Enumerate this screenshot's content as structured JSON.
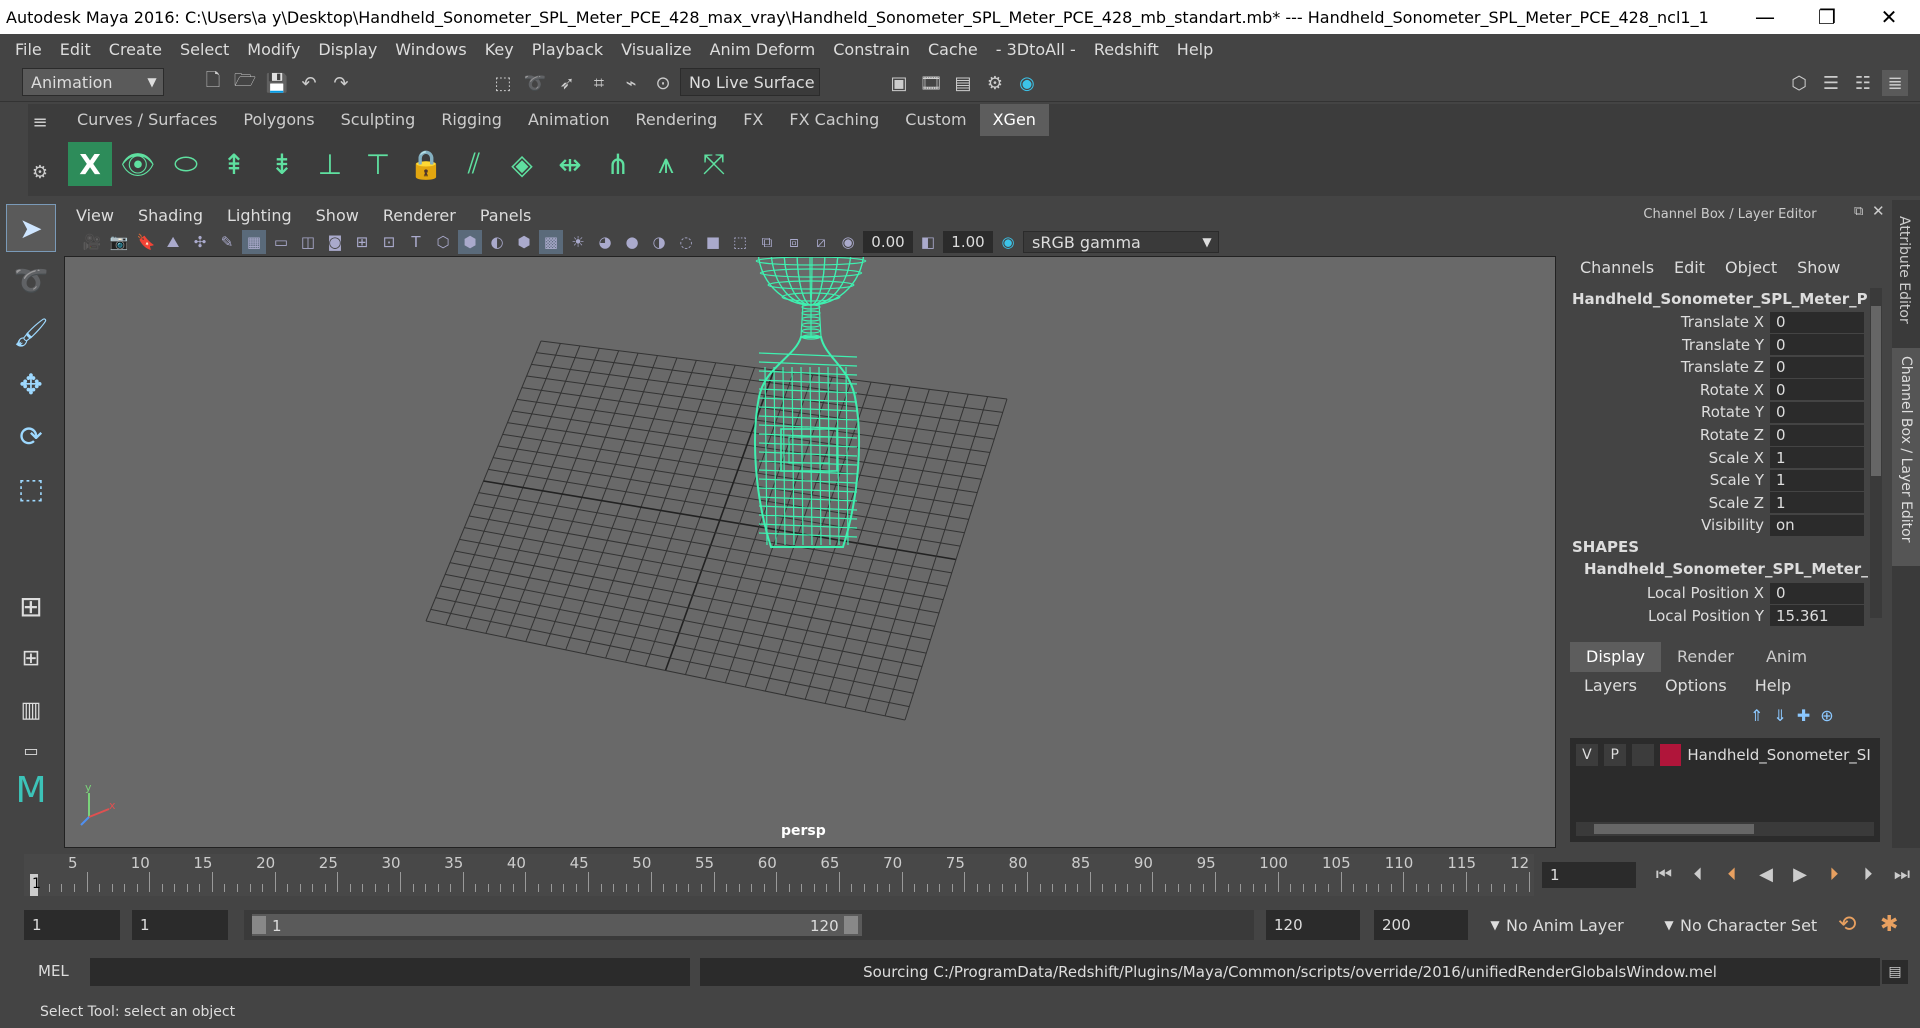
{
  "title": "Autodesk Maya 2016: C:\\Users\\a y\\Desktop\\Handheld_Sonometer_SPL_Meter_PCE_428_max_vray\\Handheld_Sonometer_SPL_Meter_PCE_428_mb_standart.mb*   ---   Handheld_Sonometer_SPL_Meter_PCE_428_ncl1_1",
  "window_controls": {
    "minimize": "—",
    "maximize": "❐",
    "close": "✕"
  },
  "menu": [
    "File",
    "Edit",
    "Create",
    "Select",
    "Modify",
    "Display",
    "Windows",
    "Key",
    "Playback",
    "Visualize",
    "Anim Deform",
    "Constrain",
    "Cache",
    "- 3DtoAll -",
    "Redshift",
    "Help"
  ],
  "status_line": {
    "menuset": "Animation",
    "live_surface": "No Live Surface"
  },
  "shelf_tabs": [
    "Curves / Surfaces",
    "Polygons",
    "Sculpting",
    "Rigging",
    "Animation",
    "Rendering",
    "FX",
    "FX Caching",
    "Custom",
    "XGen"
  ],
  "shelf_active": "XGen",
  "panel_menu": [
    "View",
    "Shading",
    "Lighting",
    "Show",
    "Renderer",
    "Panels"
  ],
  "panel_toolbar": {
    "exposure": "0.00",
    "gamma": "1.00",
    "color_space": "sRGB gamma"
  },
  "viewport": {
    "camera_label": "persp",
    "axis_labels": {
      "x": "x",
      "y": "y"
    }
  },
  "channel_box": {
    "header": "Channel Box / Layer Editor",
    "menu": [
      "Channels",
      "Edit",
      "Object",
      "Show"
    ],
    "object_name": "Handheld_Sonometer_SPL_Meter_PCE...",
    "channels": [
      {
        "label": "Translate X",
        "value": "0"
      },
      {
        "label": "Translate Y",
        "value": "0"
      },
      {
        "label": "Translate Z",
        "value": "0"
      },
      {
        "label": "Rotate X",
        "value": "0"
      },
      {
        "label": "Rotate Y",
        "value": "0"
      },
      {
        "label": "Rotate Z",
        "value": "0"
      },
      {
        "label": "Scale X",
        "value": "1"
      },
      {
        "label": "Scale Y",
        "value": "1"
      },
      {
        "label": "Scale Z",
        "value": "1"
      },
      {
        "label": "Visibility",
        "value": "on"
      }
    ],
    "shapes_header": "SHAPES",
    "shape_name": "Handheld_Sonometer_SPL_Meter_P...",
    "shape_channels": [
      {
        "label": "Local Position X",
        "value": "0"
      },
      {
        "label": "Local Position Y",
        "value": "15.361"
      }
    ]
  },
  "layer_editor": {
    "tabs": [
      "Display",
      "Render",
      "Anim"
    ],
    "active_tab": "Display",
    "menu": [
      "Layers",
      "Options",
      "Help"
    ],
    "layer": {
      "v": "V",
      "p": "P",
      "name": "Handheld_Sonometer_SI",
      "color": "#b0153a"
    }
  },
  "side_tabs": [
    "Attribute Editor",
    "Channel Box / Layer Editor"
  ],
  "timeline": {
    "ticks": [
      "5",
      "10",
      "15",
      "20",
      "25",
      "30",
      "35",
      "40",
      "45",
      "50",
      "55",
      "60",
      "65",
      "70",
      "75",
      "80",
      "85",
      "90",
      "95",
      "100",
      "105",
      "110",
      "115",
      "12"
    ],
    "start_marker": "1",
    "current_frame": "1"
  },
  "range": {
    "start": "1",
    "playback_start": "1",
    "slider_start": "1",
    "slider_end": "120",
    "playback_end": "120",
    "end": "200",
    "anim_layer": "No Anim Layer",
    "character_set": "No Character Set"
  },
  "command_line": {
    "label": "MEL",
    "output": "Sourcing C:/ProgramData/Redshift/Plugins/Maya/Common/scripts/override/2016/unifiedRenderGlobalsWindow.mel"
  },
  "help_line": "Select Tool: select an object",
  "colors": {
    "wireframe": "#3ff0b0",
    "viewport_bg": "#696969",
    "layer_color": "#b0153a"
  }
}
